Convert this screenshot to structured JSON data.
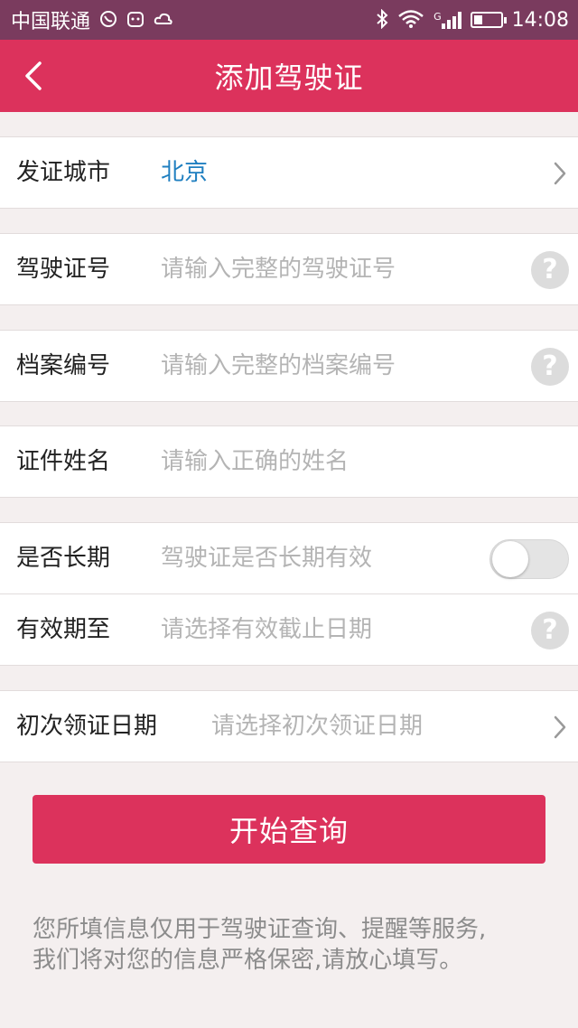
{
  "status_bar": {
    "carrier": "中国联通",
    "network_type": "G",
    "time": "14:08",
    "icons": [
      "whatsapp-icon",
      "cat-icon",
      "weather-icon",
      "bluetooth-icon",
      "wifi-icon",
      "signal-icon",
      "battery-icon"
    ]
  },
  "header": {
    "title": "添加驾驶证",
    "back_icon": "chevron-left-icon"
  },
  "form": {
    "city": {
      "label": "发证城市",
      "value": "北京"
    },
    "license_no": {
      "label": "驾驶证号",
      "placeholder": "请输入完整的驾驶证号"
    },
    "file_no": {
      "label": "档案编号",
      "placeholder": "请输入完整的档案编号"
    },
    "name": {
      "label": "证件姓名",
      "placeholder": "请输入正确的姓名"
    },
    "long_term": {
      "label": "是否长期",
      "hint": "驾驶证是否长期有效",
      "enabled": false
    },
    "valid_until": {
      "label": "有效期至",
      "placeholder": "请选择有效截止日期"
    },
    "first_issue": {
      "label": "初次领证日期",
      "placeholder": "请选择初次领证日期"
    }
  },
  "submit_label": "开始查询",
  "notice": {
    "line1": "您所填信息仅用于驾驶证查询、提醒等服务,",
    "line2": "我们将对您的信息严格保密,请放心填写。"
  },
  "colors": {
    "accent": "#dc325c",
    "status_bar": "#7a3b5e",
    "city_value": "#1f7fc0",
    "background": "#f4efef"
  }
}
